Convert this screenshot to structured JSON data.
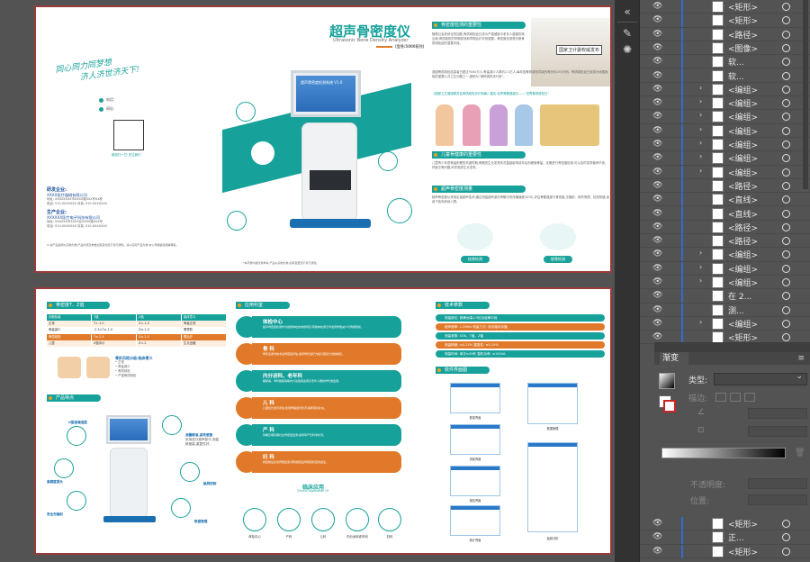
{
  "canvas": {
    "page1": {
      "slogan_line1": "同心同力同梦想",
      "slogan_line2": "济人济世济天下!",
      "contact_phone": "电话:",
      "contact_web": "网址:",
      "qr_caption": "微信扫一扫 关注我们",
      "org1_title": "研发企业:",
      "org1_name": "XXXX医疗器械有限公司",
      "org1_addr": "地址: XXXXXXXX市XXXX路XXX号XX栋",
      "org1_tel": "电话: 010-XXXXXXX  传真: 010-XXXXXXX",
      "org2_title": "生产企业:",
      "org2_name": "XXXXXX医疗电子科技有限公司",
      "org2_addr": "地址: XXXXXX市XXXX区XXXX路XXX号",
      "org2_tel": "电话: 010-XXXXXXX  传真: 010-XXXXXXX",
      "footnote": "※ 本产品说明以实物为准,产品外观及参数如有变化恕不另行通知。请以实际产品为准,本公司保留最终解释权。",
      "cover_title": "超声骨密度仪",
      "cover_subtitle": "Ultrasonic Bone Density Analyzer",
      "cover_model": "(型号:5000系列)",
      "screen_text": "超声骨密度检测系统 V1.0",
      "cart_note": "*本手册内容仅供参考,产品以实物为准,如有变更恕不另行通知。",
      "sec1_title": "骨密度检测的重要性",
      "sec1_text": "随着社会老龄化的加剧,骨质疏松症已成为严重威胁中老年人健康的常见病,骨质疏松的早期发现和早期治疗非常重要。骨密度检测是诊断骨质疏松症的重要手段。",
      "book_caption": "国家卫计委权威发布",
      "sec1_text2": "我国骨质疏松症患者已超过9000万人,骨量减少人群约2.1亿人,每年因骨质疏松导致的骨折约250万例。骨质疏松症已经成为我国面临的重要公共卫生问题之一,被称为“静悄悄的流行病”。",
      "sec1_quote": "《国家卫生健康委员会骨质疏松诊疗指南》建议:世界骨骼健康日——“世界骨质疏松日”",
      "sec2_title": "儿童骨健康的重要性",
      "sec2_text": "儿童青少年是骨量积累的关键时期,骨骼的生长发育状况直接影响成年后的峰值骨量。定期进行骨密度检测,可以及时发现营养不良、钙缺乏等问题,科学指导生长发育。",
      "sec3_title": "超声骨密度测量",
      "sec3_text": "超声骨密度仪采用定量超声技术,通过测量超声波在骨骼中的传播速度(SOS),评估骨骼强度与骨密度,无辐射、操作简便、检测快速,适用于各年龄段人群。",
      "pill1": "桡骨检测",
      "pill2": "胫骨检测"
    },
    "page2": {
      "zt_title": "骨密度T、Z值",
      "zt_headers": [
        "诊断标准",
        "T值",
        "Z值",
        "临床意义"
      ],
      "zt_row1": [
        "正常",
        "T>-1.0",
        "Z>-1.0",
        "骨量正常"
      ],
      "zt_row2": [
        "骨量减少",
        "-2.5<T≤-1.0",
        "Z≤-1.0",
        "需预防"
      ],
      "zt2_row1": [
        "骨质疏松",
        "T≤-2.5",
        "Z≤-2.0",
        "需治疗"
      ],
      "zt2_row2": [
        "儿童",
        "Z值评价",
        "Z<-2",
        "生长迟缓"
      ],
      "levels_title": "骨折风险分级:临床意义",
      "levels": [
        "• 正常",
        "• 骨量减少",
        "• 骨质疏松",
        "• 严重骨质疏松"
      ],
      "features_title": "产品特点",
      "feat1_title": "U型高端造型",
      "feat2_title": "高精度探头",
      "feat3_title": "测量精准,高效便捷",
      "feat4_title": "触屏控制",
      "feat5_title": "安全无辐射",
      "feat6_title": "数据管理",
      "feat_desc": "采用进口超声探头,测量精度高,重复性好。",
      "app_title": "应用科室",
      "apps": [
        {
          "name": "体检中心",
          "desc": "超声骨密度检测作为健康体检的常规项目,帮助体检者及早发现骨量减少与骨质疏松。"
        },
        {
          "name": "骨    科",
          "desc": "骨折患者术前术后骨密度评估,指导骨折治疗方案与康复计划的制定。"
        },
        {
          "name": "内分泌科、老年科",
          "desc": "糖尿病、甲状腺疾病等内分泌疾病患者及老年人群的骨代谢监测。"
        },
        {
          "name": "儿    科",
          "desc": "儿童生长发育评估,检测骨骼发育状况,指导营养补充。"
        },
        {
          "name": "产    科",
          "desc": "孕期及哺乳期妇女骨密度监测,指导孕产妇科学补钙。"
        },
        {
          "name": "妇    科",
          "desc": "绝经前后女性骨量监测,预防绝经后骨质疏松症的发生。"
        }
      ],
      "clinic_title": "临床应用",
      "clinic_sub": "Clinical Application Of",
      "clinic_items": [
        "体检中心",
        "产科",
        "儿科",
        "内分泌科老年科",
        "妇科"
      ],
      "tech_title": "技术参数",
      "tech_params": [
        "测量部位: 桡骨远端1/3处及胫骨中段",
        "超声频率: 1.2MHz 测量方式: 双向轴向传播",
        "测量参数: SOS、T值、Z值",
        "测量精度: ≤0.25%  重复性: ≤0.15%",
        "测量时间: 单次≤30秒 整机功率: ≤150VA",
        "电源: AC220V±22V 50Hz±1Hz"
      ],
      "soft_title": "软件界面图",
      "screens": [
        "登录界面",
        "数据管理",
        "测量界面",
        "报告界面",
        "统计界面",
        "曲线分析"
      ]
    }
  },
  "layers": [
    {
      "name": "<矩形>",
      "arrow": false
    },
    {
      "name": "<矩形>",
      "arrow": false
    },
    {
      "name": "<路径>",
      "arrow": false
    },
    {
      "name": "<图像>",
      "arrow": false
    },
    {
      "name": "软...",
      "arrow": false
    },
    {
      "name": "软...",
      "arrow": false
    },
    {
      "name": "<编组>",
      "arrow": true
    },
    {
      "name": "<编组>",
      "arrow": true
    },
    {
      "name": "<编组>",
      "arrow": true
    },
    {
      "name": "<编组>",
      "arrow": true
    },
    {
      "name": "<编组>",
      "arrow": true
    },
    {
      "name": "<编组>",
      "arrow": true
    },
    {
      "name": "<编组>",
      "arrow": true
    },
    {
      "name": "<路径>",
      "arrow": false
    },
    {
      "name": "<直线>",
      "arrow": false
    },
    {
      "name": "<直线>",
      "arrow": false
    },
    {
      "name": "<路径>",
      "arrow": false
    },
    {
      "name": "<路径>",
      "arrow": false
    },
    {
      "name": "<编组>",
      "arrow": true
    },
    {
      "name": "<编组>",
      "arrow": true
    },
    {
      "name": "<编组>",
      "arrow": true
    },
    {
      "name": "在 2...",
      "arrow": false
    },
    {
      "name": "测...",
      "arrow": false
    },
    {
      "name": "<编组>",
      "arrow": true
    },
    {
      "name": "<矩形>",
      "arrow": false
    }
  ],
  "layers_bottom": [
    {
      "name": "<矩形>"
    },
    {
      "name": "正..."
    },
    {
      "name": "<矩形>"
    }
  ],
  "gradient_panel": {
    "tab": "渐变",
    "type_label": "类型:",
    "stroke_label": "描边:",
    "opacity_label": "不透明度:",
    "position_label": "位置:"
  },
  "colors": {
    "teal": "#16a19a",
    "orange": "#e07a2a",
    "artboard_border": "#9b3a3a",
    "selection_blue": "#2d6bd6"
  }
}
